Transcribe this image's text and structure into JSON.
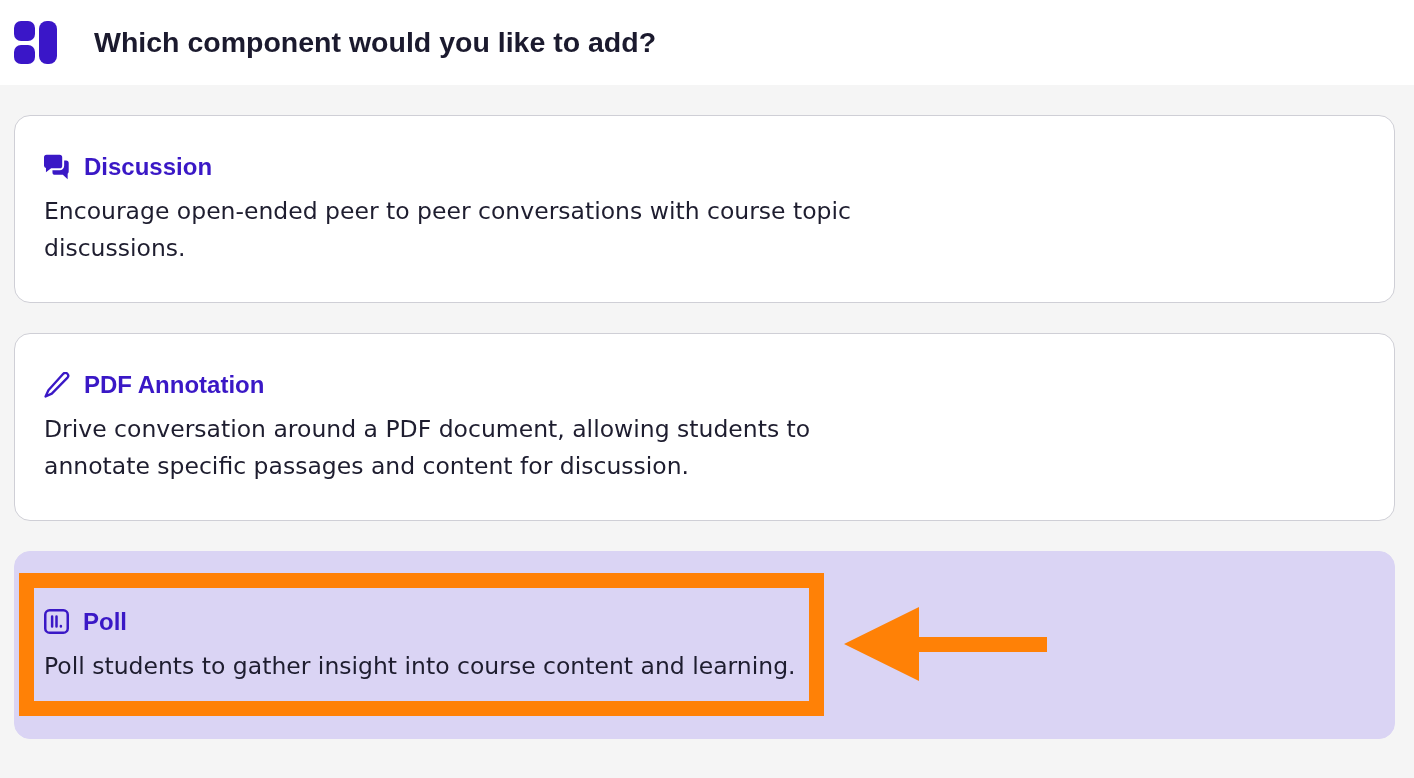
{
  "header": {
    "title": "Which component would you like to add?"
  },
  "components": [
    {
      "kind": "discussion",
      "title": "Discussion",
      "description": "Encourage open-ended peer to peer conversations with course topic discussions.",
      "selected": false,
      "highlighted": false
    },
    {
      "kind": "annotation",
      "title": "PDF Annotation",
      "description": "Drive conversation around a PDF document, allowing students to annotate specific passages and content for discussion.",
      "selected": false,
      "highlighted": false
    },
    {
      "kind": "poll",
      "title": "Poll",
      "description": "Poll students to gather insight into course content and learning.",
      "selected": true,
      "highlighted": true
    }
  ]
}
